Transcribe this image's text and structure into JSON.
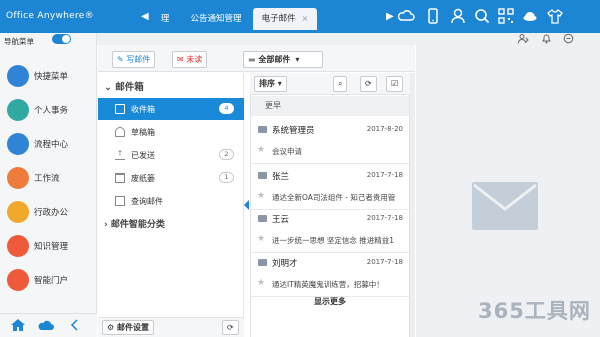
{
  "app": {
    "logo": "Office Anywhere®",
    "accent": "#1d86d4"
  },
  "tabs": [
    {
      "label": "理"
    },
    {
      "label": "公告通知管理"
    },
    {
      "label": "电子邮件",
      "active": true,
      "close": "×"
    }
  ],
  "nav_arrows": {
    "prev": "◀",
    "next": "▶"
  },
  "top_icons": [
    "cloud-icon",
    "mobile-icon",
    "user-icon",
    "search-icon",
    "qr-code-icon",
    "plate-icon",
    "shirt-icon"
  ],
  "sub_icons": [
    "users-icon",
    "bell-icon",
    "chat-icon"
  ],
  "sidebar": {
    "toggle_label": "导航菜单",
    "toggle_on": true,
    "items": [
      {
        "label": "快捷菜单",
        "icon": "rocket-icon",
        "color": "#2f84d6"
      },
      {
        "label": "个人事务",
        "icon": "person-icon",
        "color": "#31a9a3"
      },
      {
        "label": "流程中心",
        "icon": "process-icon",
        "color": "#2f84d6"
      },
      {
        "label": "工作流",
        "icon": "workflow-icon",
        "color": "#ef7b3c"
      },
      {
        "label": "行政办公",
        "icon": "admin-icon",
        "color": "#f0a92a"
      },
      {
        "label": "知识管理",
        "icon": "book-icon",
        "color": "#ef5b3a"
      },
      {
        "label": "智能门户",
        "icon": "portal-icon",
        "color": "#ef5b3a"
      }
    ],
    "bottom_icons": [
      "home-icon",
      "cloud-icon",
      "collapse-icon"
    ]
  },
  "toolbar": {
    "compose_label": "写邮件",
    "unread_label": "未读",
    "folder_select": "全部邮件"
  },
  "folders": {
    "heading": "邮件箱",
    "items": [
      {
        "label": "收件箱",
        "count": "4",
        "selected": true
      },
      {
        "label": "草稿箱",
        "count": ""
      },
      {
        "label": "已发送",
        "count": "2"
      },
      {
        "label": "废纸篓",
        "count": "1"
      },
      {
        "label": "查询邮件",
        "count": ""
      }
    ],
    "category": "邮件智能分类",
    "settings_label": "邮件设置"
  },
  "list": {
    "sort_label": "排序",
    "group_label": "更早",
    "mails": [
      {
        "sender": "系统管理员",
        "date": "2017-8-20",
        "subject": "会议申请"
      },
      {
        "sender": "张兰",
        "date": "2017-7-18",
        "subject": "通达全新OA司法组件 - 知己者贵用管"
      },
      {
        "sender": "王云",
        "date": "2017-7-18",
        "subject": "进一步统一思想 坚定信念 推进精益1"
      },
      {
        "sender": "刘明才",
        "date": "2017-7-18",
        "subject": "通达IT精英魔鬼训练营，招募中！"
      }
    ],
    "show_more": "显示更多"
  },
  "watermark": "365工具网"
}
